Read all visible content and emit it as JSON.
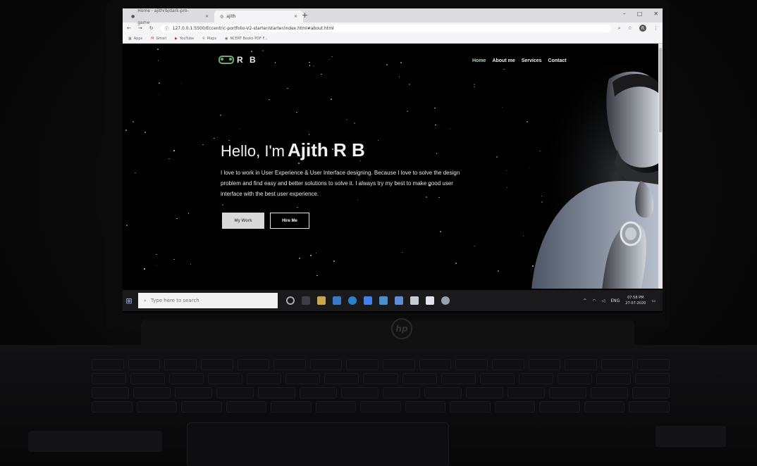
{
  "browser": {
    "tabs": [
      {
        "title": "Home · ajithrb/dark-pro-game"
      },
      {
        "title": "ajith"
      }
    ],
    "url": "127.0.0.1:5500/Eccentric-portfolio-V2-starter/starter/index.html#about.html",
    "bookmarks": [
      "Apps",
      "Gmail",
      "YouTube",
      "Maps",
      "NCERT Books PDF F..."
    ],
    "profile_initial": "R"
  },
  "site": {
    "logo_text": "R B",
    "nav": [
      "Home",
      "About me",
      "Services",
      "Contact"
    ],
    "greeting": "Hello, I'm",
    "name": "Ajith R B",
    "intro": "I love to work in User Experience & User Interface designing. Because I love to solve the design problem and find easy and better solutions to solve it. I always try my best to make good user interface with the best user experience.",
    "buttons": {
      "work": "My Work",
      "hire": "Hire Me"
    }
  },
  "taskbar": {
    "search_placeholder": "Type here to search",
    "language": "ENG",
    "time": "07:58 PM",
    "date": "27-07-2020"
  },
  "colors": {
    "accent": "#6fa96f",
    "page_bg": "#000000",
    "button_light": "#d9d9d9"
  }
}
